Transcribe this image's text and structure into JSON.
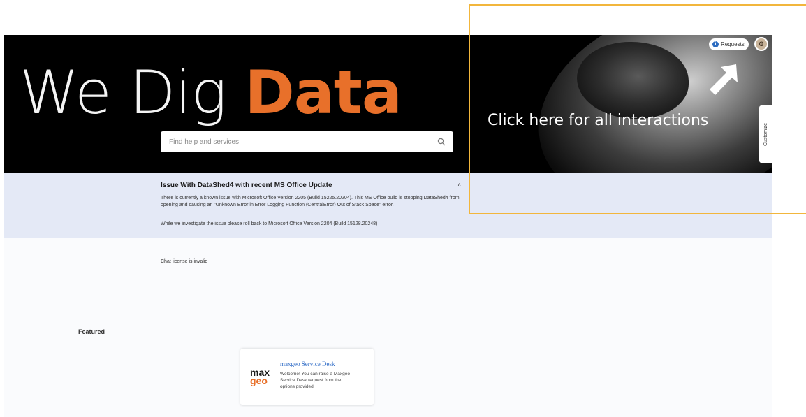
{
  "hero": {
    "title_part1": "We Dig ",
    "title_part2": "Data",
    "accent_color": "#e8702a"
  },
  "header": {
    "requests_label": "Requests",
    "avatar_initial": "G",
    "customize_label": "Customize"
  },
  "search": {
    "placeholder": "Find help and services",
    "icon": "search-icon"
  },
  "banner": {
    "title": "Issue With DataShed4 with recent MS Office Update",
    "text1": "There is currently a known issue with Microsoft Office Version 2205 (Build 15225.20204). This MS Office build is stopping DataShed4 from opening and causing an \"Unknown Error in Error Logging Function (CentralError) Out of Stack Space\" error.",
    "text2": "While we investigate the issue please roll back to Microsoft Office Version 2204 (Build 15128.20248)",
    "background": "#e4e9f6"
  },
  "main": {
    "chat_message": "Chat license is invalid",
    "featured_heading": "Featured"
  },
  "card": {
    "logo_line1": "max",
    "logo_line2": "geo",
    "title": "maxgeo Service Desk",
    "description": "Welcome! You can raise a Maxgeo Service Desk request from the options provided."
  },
  "annotation": {
    "text": "Click here for all interactions",
    "box_color": "#f2b63c"
  }
}
